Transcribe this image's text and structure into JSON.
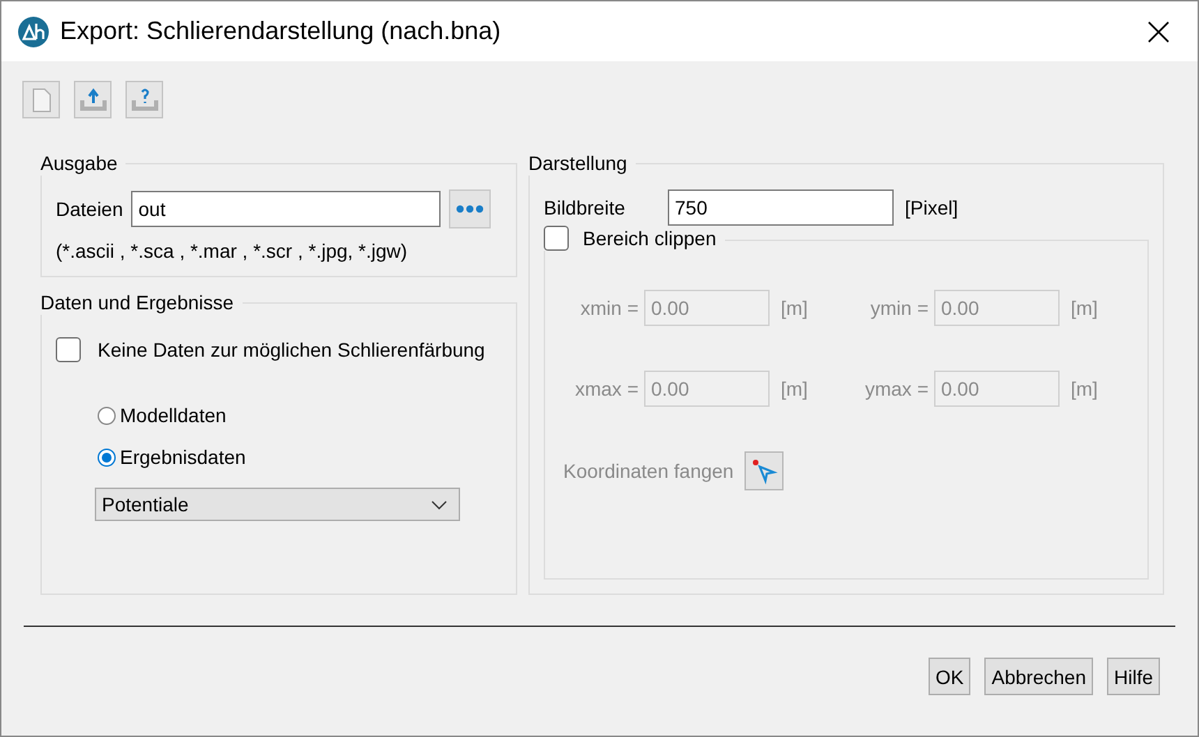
{
  "window": {
    "title": "Export: Schlierendarstellung (nach.bna)"
  },
  "output": {
    "title": "Ausgabe",
    "files_label": "Dateien",
    "files_value": "out",
    "extensions": "(*.ascii , *.sca , *.mar , *.scr , *.jpg, *.jgw)"
  },
  "data": {
    "title": "Daten und Ergebnisse",
    "no_data": {
      "label": "Keine Daten zur möglichen Schlierenfärbung",
      "checked": false
    },
    "options": [
      {
        "label": "Modelldaten",
        "selected": false
      },
      {
        "label": "Ergebnisdaten",
        "selected": true
      }
    ],
    "dropdown": {
      "value": "Potentiale"
    }
  },
  "display": {
    "title": "Darstellung",
    "width_label": "Bildbreite",
    "width_value": "750",
    "width_unit": "[Pixel]",
    "clip": {
      "label": "Bereich clippen",
      "checked": false
    },
    "fields": [
      {
        "label": "xmin =",
        "value": "0.00",
        "unit": "[m]"
      },
      {
        "label": "ymin =",
        "value": "0.00",
        "unit": "[m]"
      },
      {
        "label": "xmax =",
        "value": "0.00",
        "unit": "[m]"
      },
      {
        "label": "ymax =",
        "value": "0.00",
        "unit": "[m]"
      }
    ],
    "capture_label": "Koordinaten fangen"
  },
  "buttons": [
    "OK",
    "Abbrechen",
    "Hilfe"
  ]
}
